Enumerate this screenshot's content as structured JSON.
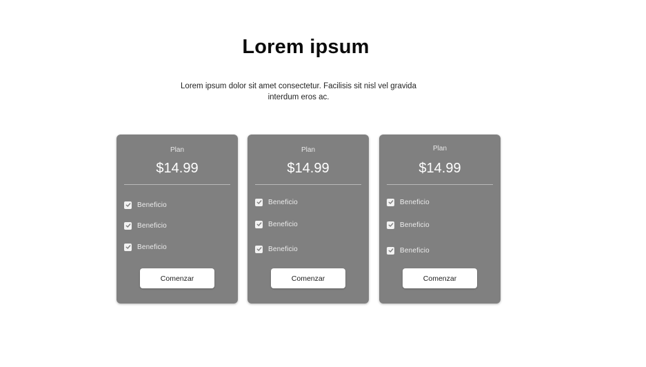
{
  "header": {
    "title": "Lorem ipsum",
    "description_line1": "Lorem ipsum dolor sit amet consectetur.  Facilisis sit nisl vel gravida",
    "description_line2": "interdum eros ac."
  },
  "cards": [
    {
      "plan_label": "Plan",
      "price": "$14.99",
      "benefits": [
        "Beneficio",
        "Beneficio",
        "Beneficio"
      ],
      "cta_label": "Comenzar"
    },
    {
      "plan_label": "Plan",
      "price": "$14.99",
      "benefits": [
        "Beneficio",
        "Beneficio",
        "Beneficio"
      ],
      "cta_label": "Comenzar"
    },
    {
      "plan_label": "Plan",
      "price": "$14.99",
      "benefits": [
        "Beneficio",
        "Beneficio",
        "Beneficio"
      ],
      "cta_label": "Comenzar"
    }
  ],
  "icons": {
    "benefit_check": "checkbox-checked-icon"
  },
  "colors": {
    "card_background": "#808080",
    "button_background": "#ffffff",
    "page_background": "#ffffff"
  }
}
